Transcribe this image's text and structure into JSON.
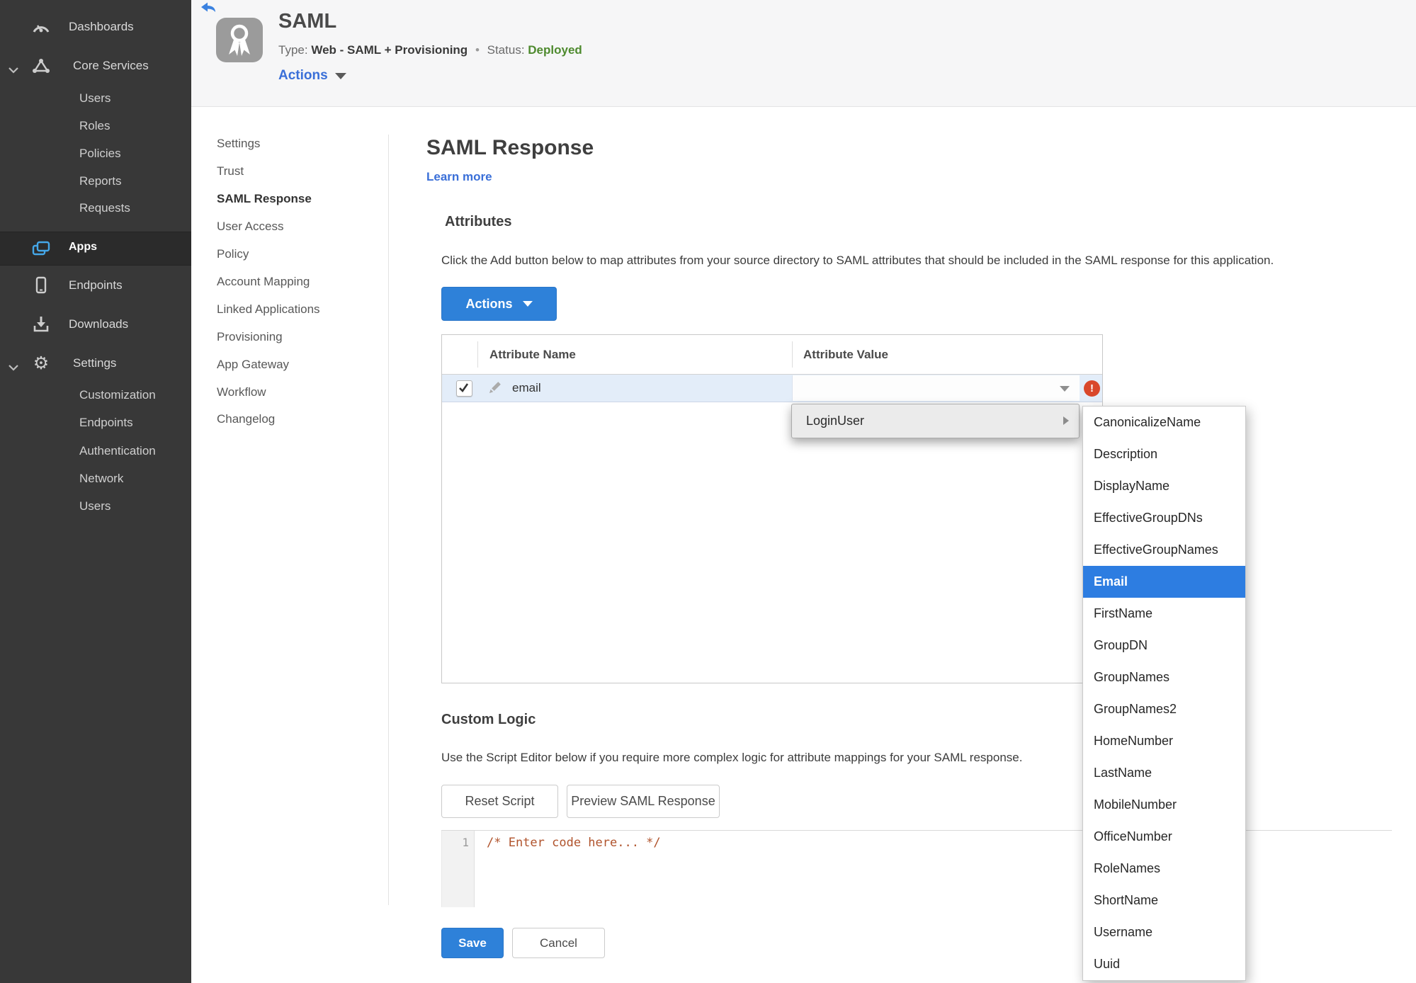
{
  "colors": {
    "accent_blue": "#2E81D9",
    "link_blue": "#3A6FD8",
    "menu_highlight_blue": "#2D7DE1",
    "apps_icon_blue": "#45A7E8",
    "status_green": "#4E8A2E",
    "error_red": "#D9472B",
    "sidebar_bg": "#383838",
    "selected_row_blue": "#E3EDF9",
    "code_comment_orange": "#B0532C"
  },
  "sidebar": {
    "dashboards": "Dashboards",
    "core_services": "Core Services",
    "users": "Users",
    "roles": "Roles",
    "policies": "Policies",
    "reports": "Reports",
    "requests": "Requests",
    "apps": "Apps",
    "endpoints": "Endpoints",
    "downloads": "Downloads",
    "settings": "Settings",
    "customization": "Customization",
    "endpoints2": "Endpoints",
    "authentication": "Authentication",
    "network": "Network",
    "users2": "Users"
  },
  "header": {
    "title": "SAML",
    "type_label": "Type:",
    "type_value": "Web - SAML + Provisioning",
    "dot": "•",
    "status_label": "Status:",
    "status_value": "Deployed",
    "actions": "Actions"
  },
  "subnav": {
    "settings": "Settings",
    "trust": "Trust",
    "saml_response": "SAML Response",
    "user_access": "User Access",
    "policy": "Policy",
    "account_mapping": "Account Mapping",
    "linked_applications": "Linked Applications",
    "provisioning": "Provisioning",
    "app_gateway": "App Gateway",
    "workflow": "Workflow",
    "changelog": "Changelog"
  },
  "main": {
    "title": "SAML Response",
    "learn_more": "Learn more",
    "attributes_heading": "Attributes",
    "attributes_description": "Click the Add button below to map attributes from your source directory to SAML attributes that should be included in the SAML response for this application.",
    "actions_button": "Actions",
    "table": {
      "col_name": "Attribute Name",
      "col_value": "Attribute Value",
      "row_name": "email",
      "row_value": ""
    },
    "custom_logic_heading": "Custom Logic",
    "custom_logic_description": "Use the Script Editor below if you require more complex logic for attribute mappings for your SAML response.",
    "reset_button": "Reset Script",
    "preview_button": "Preview SAML Response",
    "editor": {
      "line_number": "1",
      "code": "/* Enter code here... */"
    },
    "save": "Save",
    "cancel": "Cancel"
  },
  "menu": {
    "parent": "LoginUser",
    "selected": "Email",
    "items": [
      "CanonicalizeName",
      "Description",
      "DisplayName",
      "EffectiveGroupDNs",
      "EffectiveGroupNames",
      "Email",
      "FirstName",
      "GroupDN",
      "GroupNames",
      "GroupNames2",
      "HomeNumber",
      "LastName",
      "MobileNumber",
      "OfficeNumber",
      "RoleNames",
      "ShortName",
      "Username",
      "Uuid"
    ]
  }
}
